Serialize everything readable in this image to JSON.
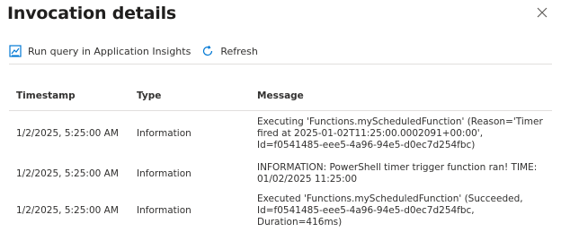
{
  "dialog": {
    "title": "Invocation details",
    "close_icon": "close-icon"
  },
  "toolbar": {
    "run_query_label": "Run query in Application Insights",
    "run_query_icon": "chart-icon",
    "refresh_label": "Refresh",
    "refresh_icon": "refresh-icon"
  },
  "table": {
    "headers": {
      "timestamp": "Timestamp",
      "type": "Type",
      "message": "Message"
    },
    "rows": [
      {
        "timestamp": "1/2/2025, 5:25:00 AM",
        "type": "Information",
        "message": "Executing 'Functions.myScheduledFunction' (Reason='Timer fired at 2025-01-02T11:25:00.0002091+00:00', Id=f0541485-eee5-4a96-94e5-d0ec7d254fbc)"
      },
      {
        "timestamp": "1/2/2025, 5:25:00 AM",
        "type": "Information",
        "message": "INFORMATION: PowerShell timer trigger function ran! TIME: 01/02/2025 11:25:00"
      },
      {
        "timestamp": "1/2/2025, 5:25:00 AM",
        "type": "Information",
        "message": "Executed 'Functions.myScheduledFunction' (Succeeded, Id=f0541485-eee5-4a96-94e5-d0ec7d254fbc, Duration=416ms)"
      }
    ]
  },
  "colors": {
    "accent": "#0078d4",
    "text": "#323130",
    "border": "#e1dfdd"
  }
}
